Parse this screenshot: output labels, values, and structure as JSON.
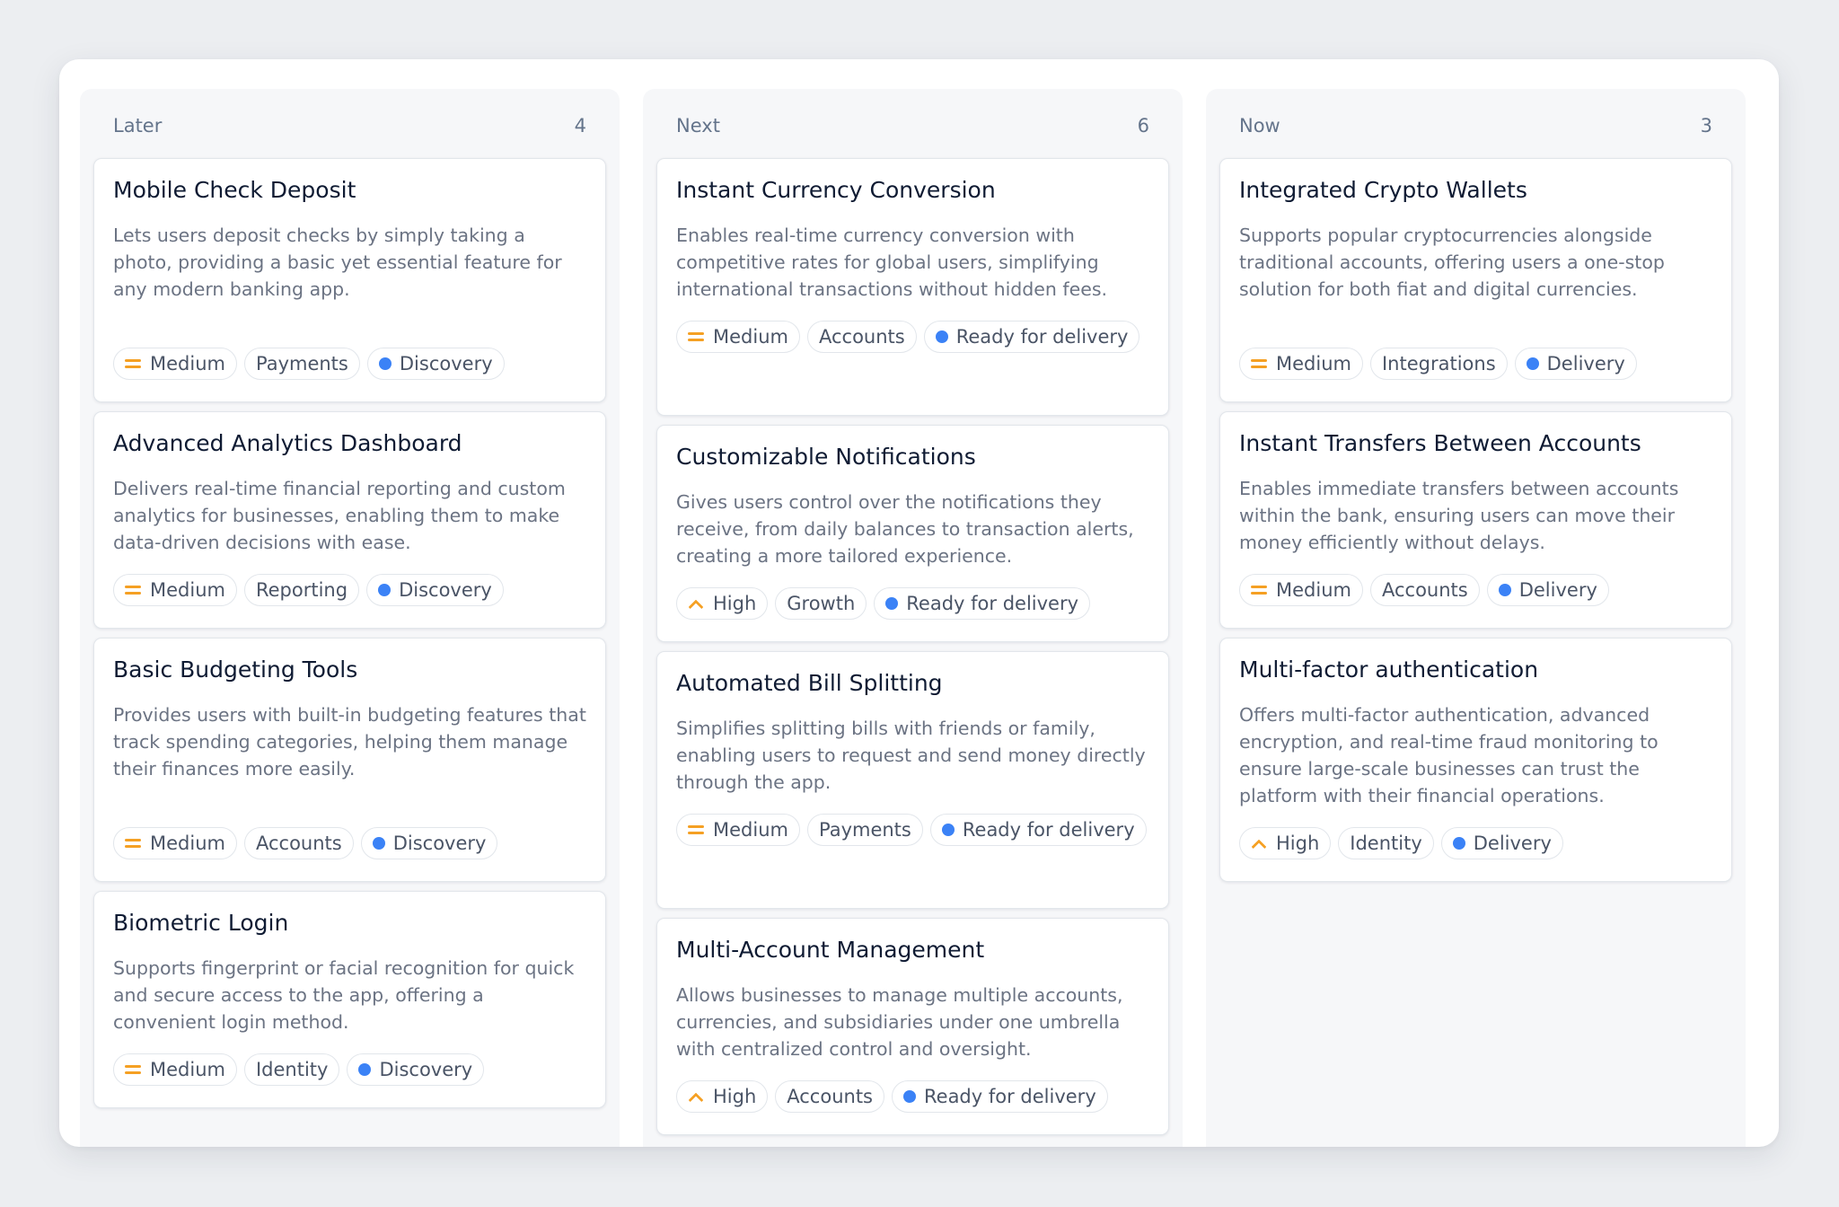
{
  "board": {
    "columns": [
      {
        "title": "Later",
        "count": "4",
        "cards": [
          {
            "title": "Mobile Check Deposit",
            "description": "Lets users deposit checks by simply taking a photo, providing a basic yet essential feature for any modern banking app.",
            "priority": "Medium",
            "priority_icon": "medium-priority-icon",
            "category": "Payments",
            "status": "Discovery"
          },
          {
            "title": "Advanced Analytics Dashboard",
            "description": "Delivers real-time financial reporting and custom analytics for businesses, enabling them to make data-driven decisions with ease.",
            "priority": "Medium",
            "priority_icon": "medium-priority-icon",
            "category": "Reporting",
            "status": "Discovery"
          },
          {
            "title": "Basic Budgeting Tools",
            "description": "Provides users with built-in budgeting features that track spending categories, helping them manage their finances more easily.",
            "priority": "Medium",
            "priority_icon": "medium-priority-icon",
            "category": "Accounts",
            "status": "Discovery"
          },
          {
            "title": "Biometric Login",
            "description": "Supports fingerprint or facial recognition for quick and secure access to the app, offering a convenient login method.",
            "priority": "Medium",
            "priority_icon": "medium-priority-icon",
            "category": "Identity",
            "status": "Discovery"
          }
        ]
      },
      {
        "title": "Next",
        "count": "6",
        "cards": [
          {
            "title": "Instant Currency Conversion",
            "description": "Enables real-time currency conversion with competitive rates for global users, simplifying international transactions without hidden fees.",
            "priority": "Medium",
            "priority_icon": "medium-priority-icon",
            "category": "Accounts",
            "status": "Ready for delivery"
          },
          {
            "title": "Customizable Notifications",
            "description": "Gives users control over the notifications they receive, from daily balances to transaction alerts, creating a more tailored experience.",
            "priority": "High",
            "priority_icon": "high-priority-icon",
            "category": "Growth",
            "status": "Ready for delivery"
          },
          {
            "title": "Automated Bill Splitting",
            "description": "Simplifies splitting bills with friends or family, enabling users to request and send money directly through the app.",
            "priority": "Medium",
            "priority_icon": "medium-priority-icon",
            "category": "Payments",
            "status": "Ready for delivery"
          },
          {
            "title": "Multi-Account Management",
            "description": "Allows businesses to manage multiple accounts, currencies, and subsidiaries under one umbrella with centralized control and oversight.",
            "priority": "High",
            "priority_icon": "high-priority-icon",
            "category": "Accounts",
            "status": "Ready for delivery"
          }
        ]
      },
      {
        "title": "Now",
        "count": "3",
        "cards": [
          {
            "title": "Integrated Crypto Wallets",
            "description": "Supports popular cryptocurrencies alongside traditional accounts, offering users a one-stop solution for both fiat and digital currencies.",
            "priority": "Medium",
            "priority_icon": "medium-priority-icon",
            "category": "Integrations",
            "status": "Delivery"
          },
          {
            "title": "Instant Transfers Between Accounts",
            "description": "Enables immediate transfers between accounts within the bank, ensuring users can move their money efficiently without delays.",
            "priority": "Medium",
            "priority_icon": "medium-priority-icon",
            "category": "Accounts",
            "status": "Delivery"
          },
          {
            "title": "Multi-factor authentication",
            "description": "Offers multi-factor authentication, advanced encryption, and real-time fraud monitoring to ensure large-scale businesses can trust the platform with their financial operations.",
            "priority": "High",
            "priority_icon": "high-priority-icon",
            "category": "Identity",
            "status": "Delivery"
          }
        ]
      }
    ]
  },
  "colors": {
    "page_background": "#eceef1",
    "column_background": "#f6f7f9",
    "card_title": "#0f1b33",
    "card_description": "#6b7383",
    "priority_accent": "#f5a023",
    "status_dot": "#3b82f6"
  }
}
